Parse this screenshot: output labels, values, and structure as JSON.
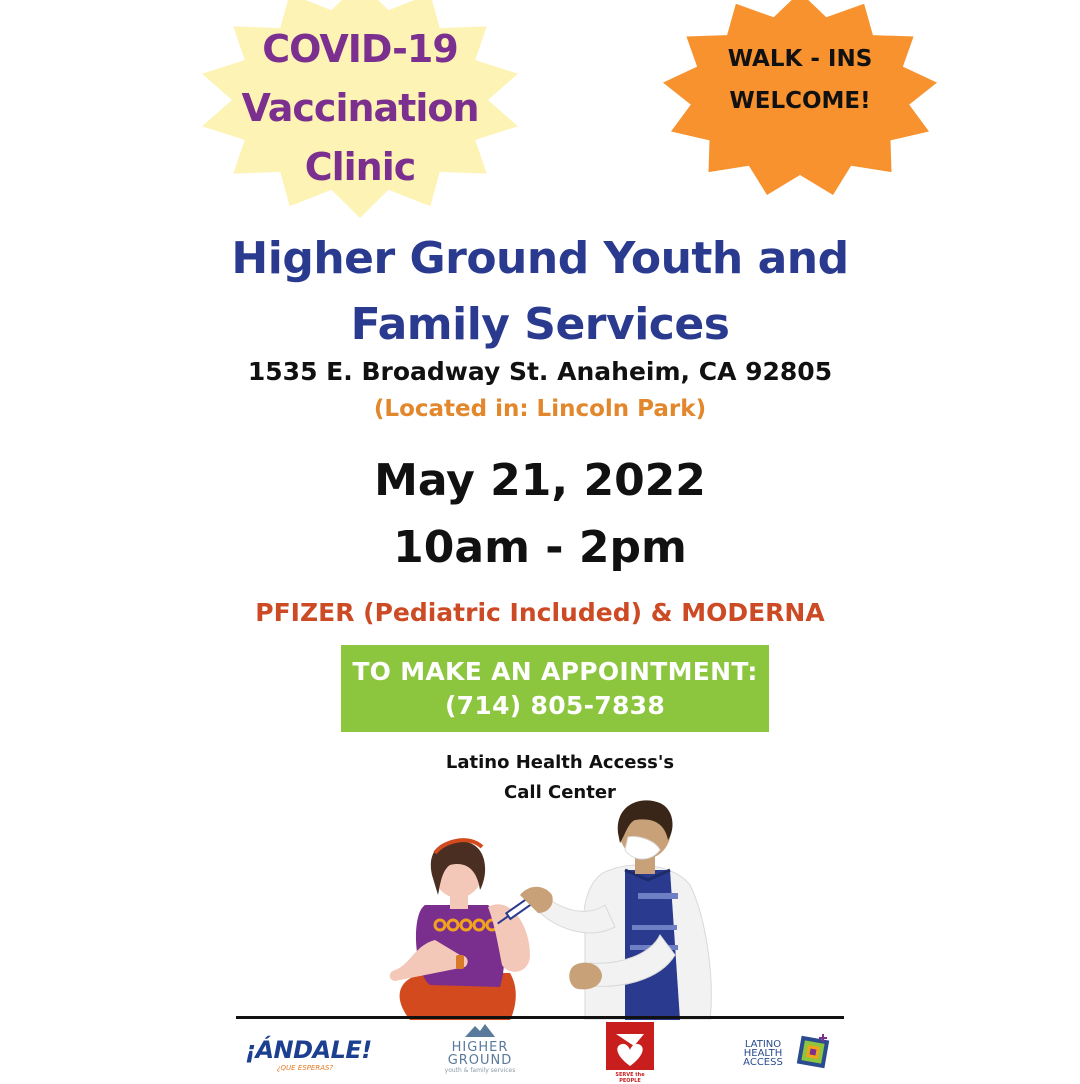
{
  "flyer": {
    "badge_title_lines": [
      "COVID-19",
      "Vaccination",
      "Clinic"
    ],
    "badge_walkins_lines": [
      "WALK - INS",
      "WELCOME!"
    ],
    "org_name_lines": [
      "Higher Ground Youth and",
      "Family Services"
    ],
    "address": "1535 E. Broadway St. Anaheim, CA 92805",
    "location_note": "(Located in: Lincoln Park)",
    "date": "May 21, 2022",
    "time": "10am - 2pm",
    "vaccines": "PFIZER (Pediatric Included) & MODERNA",
    "appointment": {
      "label": "TO MAKE AN APPOINTMENT:",
      "phone": "(714) 805-7838"
    },
    "call_center_lines": [
      "Latino Health Access's",
      "Call Center"
    ]
  },
  "logos": {
    "andale": {
      "main": "¡ÁNDALE!",
      "sub": "¿QUE ESPERAS?"
    },
    "higher_ground": {
      "line1": "HIGHER",
      "line2": "GROUND",
      "line3": "youth & family services"
    },
    "serve_the_people": {
      "caption": "SERVE the PEOPLE"
    },
    "latino_health_access": {
      "lines": [
        "LATINO",
        "HEALTH",
        "ACCESS"
      ]
    }
  },
  "colors": {
    "purple": "#7b2f8e",
    "navy": "#2a3b8f",
    "orange": "#f7922f",
    "yellow": "#fdf3b4",
    "green": "#8cc63f",
    "red_orange": "#cc4a24"
  }
}
